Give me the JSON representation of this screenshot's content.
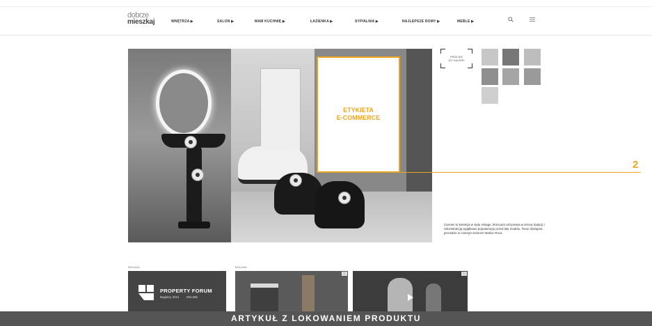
{
  "logo": {
    "line1": "dobrze",
    "line2": "mieszkaj"
  },
  "nav": {
    "items": [
      "WNĘTRZA ▶",
      "SALON ▶",
      "MAM KUCHNIĘ ▶",
      "ŁAZIENKA ▶",
      "SYPIALNIA ▶",
      "NAJLEPSZE DOMY ▶",
      "MEBLE ▶"
    ],
    "search_icon": "search-icon",
    "menu_icon": "hamburger-icon"
  },
  "gallery": {
    "button_label_1": "PRZEJDŹ",
    "button_label_2": "DO GALERII"
  },
  "overlay": {
    "label_line1": "ETYKIETA",
    "label_line2": "E-COMMERCE",
    "marker": "2",
    "accent_color": "#e8a523"
  },
  "description": "Carmen to kolekcja w stylu vintage, która jest utrzymana w stronę tradycji i rekonstrukcją wyjątkowo popularnego przed laty modelu. Teraz dostępna jest także w czarnym kolorze! Marka: Roca",
  "ads": {
    "label": "REKLAMA",
    "ad1_title": "PROPERTY FORUM",
    "ad1_subtitle": "Baglany 2021",
    "ad1_online": "ONLINE"
  },
  "footer": {
    "title": "ARTYKUŁ Z LOKOWANIEM PRODUKTU"
  }
}
